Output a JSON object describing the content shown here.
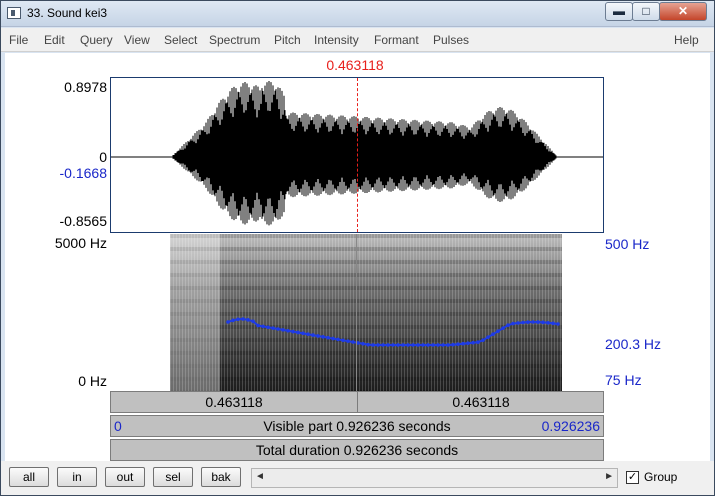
{
  "window": {
    "title": "33. Sound kei3"
  },
  "title_buttons": {
    "minimize": "▬",
    "maximize": "□",
    "close": "✕"
  },
  "menu": [
    "File",
    "Edit",
    "Query",
    "View",
    "Select",
    "Spectrum",
    "Pitch",
    "Intensity",
    "Formant",
    "Pulses"
  ],
  "help": "Help",
  "cursor_time": "0.463118",
  "waveform": {
    "max_label": "0.8978",
    "zero_label": "0",
    "cursor_value_label": "-0.1668",
    "min_label": "-0.8565",
    "colors": {
      "signal": "#000000",
      "cursor": "#e8201c",
      "cursor_value": "#1a27c9"
    }
  },
  "spectrogram": {
    "top_label": "5000 Hz",
    "bottom_label": "0 Hz",
    "pitch_top_label": "500 Hz",
    "pitch_cursor_label": "200.3 Hz",
    "pitch_bottom_label": "75 Hz",
    "colors": {
      "pitch": "#1e3be6"
    }
  },
  "time_bars": {
    "left_half": "0.463118",
    "right_half": "0.463118",
    "visible_start": "0",
    "visible_end": "0.926236",
    "visible_part": "Visible part 0.926236 seconds",
    "total_duration": "Total duration 0.926236 seconds"
  },
  "bottom": {
    "buttons": [
      "all",
      "in",
      "out",
      "sel",
      "bak"
    ],
    "scroll_left": "◄",
    "scroll_right": "►",
    "group_checked": "✓",
    "group_label": "Group"
  }
}
